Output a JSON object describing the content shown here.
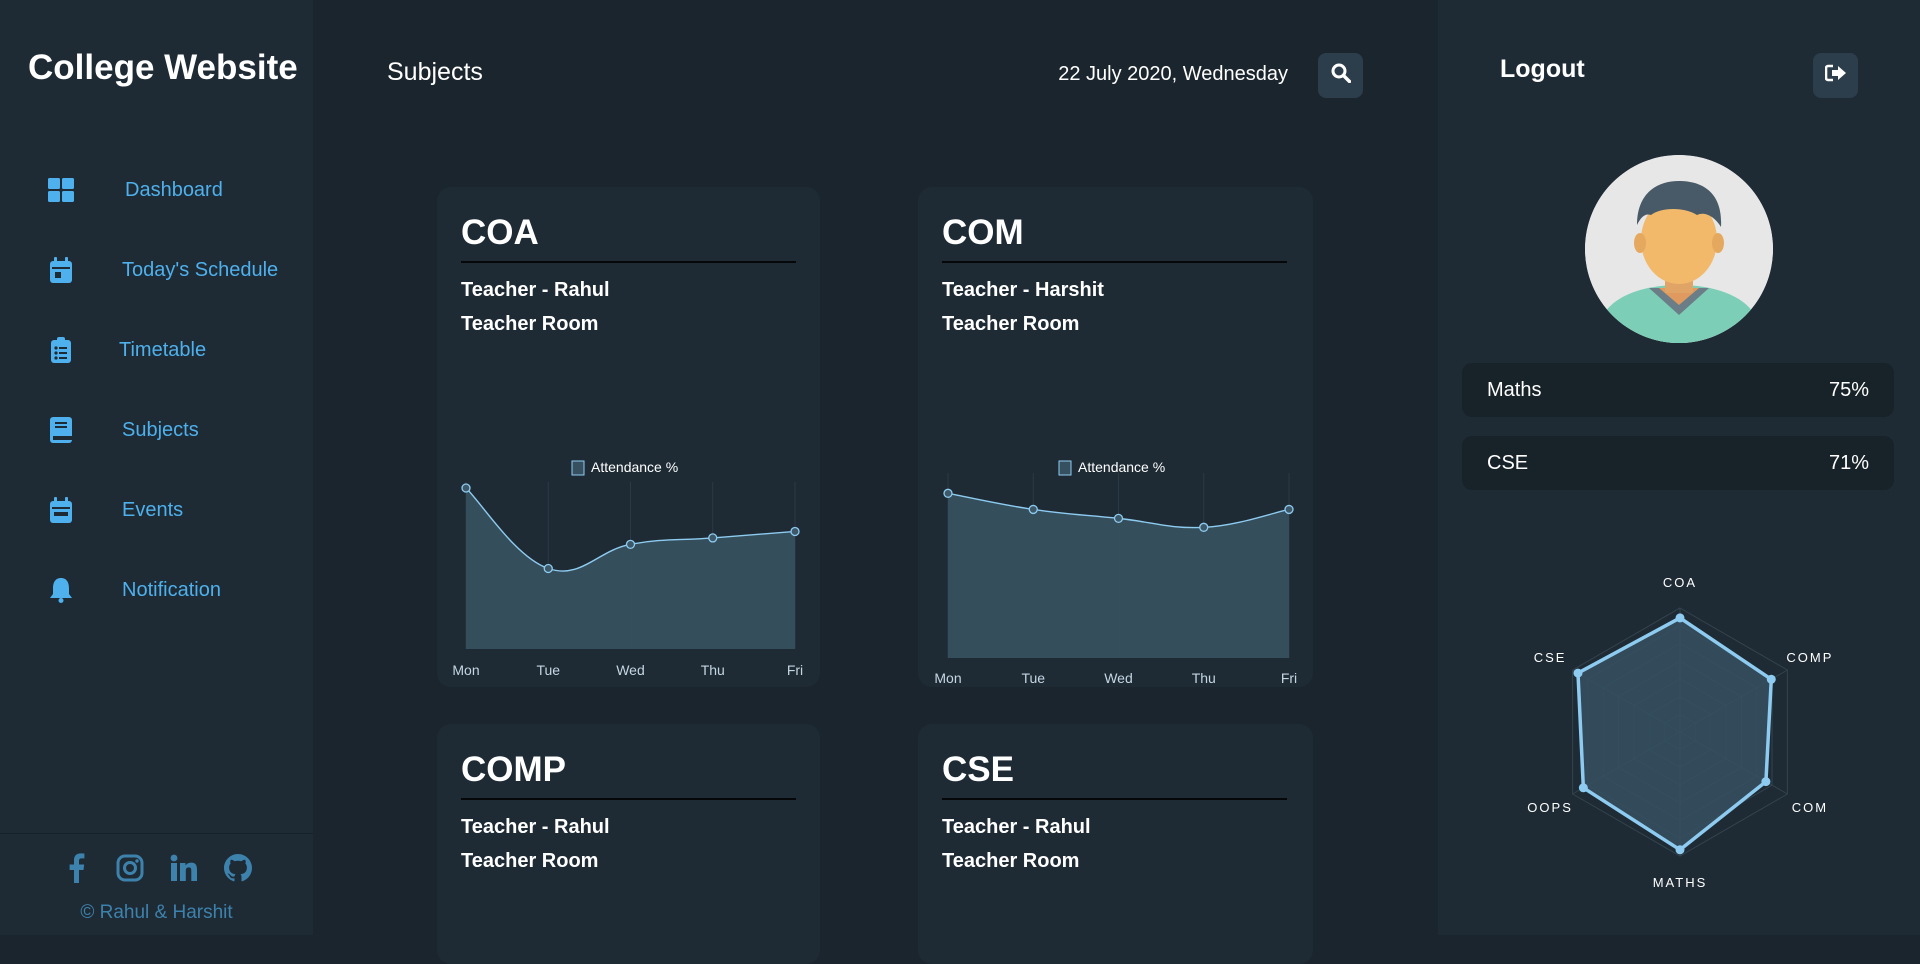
{
  "app": {
    "title": "College Website"
  },
  "sidebar": {
    "items": [
      {
        "label": "Dashboard",
        "icon": "dashboard-icon"
      },
      {
        "label": "Today's Schedule",
        "icon": "calendar-icon"
      },
      {
        "label": "Timetable",
        "icon": "clipboard-list-icon"
      },
      {
        "label": "Subjects",
        "icon": "book-icon"
      },
      {
        "label": "Events",
        "icon": "calendar-event-icon"
      },
      {
        "label": "Notification",
        "icon": "bell-icon"
      }
    ],
    "socials": [
      "facebook-icon",
      "instagram-icon",
      "linkedin-icon",
      "github-icon"
    ],
    "copyright": "© Rahul & Harshit"
  },
  "header": {
    "page_title": "Subjects",
    "date": "22 July 2020, Wednesday",
    "search_icon": "search-icon"
  },
  "subjects": [
    {
      "name": "COA",
      "teacher": "Teacher - Rahul",
      "room": "Teacher Room"
    },
    {
      "name": "COM",
      "teacher": "Teacher - Harshit",
      "room": "Teacher Room"
    },
    {
      "name": "COMP",
      "teacher": "Teacher - Rahul",
      "room": "Teacher Room"
    },
    {
      "name": "CSE",
      "teacher": "Teacher - Rahul",
      "room": "Teacher Room"
    }
  ],
  "chart_data": [
    {
      "type": "area",
      "subject": "COA",
      "legend": "Attendance %",
      "x": [
        "Mon",
        "Tue",
        "Wed",
        "Thu",
        "Fri"
      ],
      "series": [
        {
          "name": "Attendance %",
          "values": [
            100,
            50,
            65,
            69,
            73
          ]
        }
      ],
      "ylim": [
        0,
        100
      ],
      "grid": true,
      "legend_position": "top-center"
    },
    {
      "type": "area",
      "subject": "COM",
      "legend": "Attendance %",
      "x": [
        "Mon",
        "Tue",
        "Wed",
        "Thu",
        "Fri"
      ],
      "series": [
        {
          "name": "Attendance %",
          "values": [
            92,
            83,
            78,
            73,
            83
          ]
        }
      ],
      "ylim": [
        0,
        100
      ],
      "grid": true,
      "legend_position": "top-center"
    },
    {
      "type": "radar",
      "categories": [
        "COA",
        "COMP",
        "COM",
        "MATHS",
        "OOPS",
        "CSE"
      ],
      "series": [
        {
          "values": [
            92,
            85,
            80,
            95,
            90,
            95
          ]
        }
      ],
      "rlim": [
        0,
        100
      ],
      "grid": true
    }
  ],
  "profile": {
    "logout_label": "Logout",
    "logout_icon": "sign-out-icon",
    "avatar_icon": "user-avatar-icon",
    "stats": [
      {
        "subject": "Maths",
        "value": "75%"
      },
      {
        "subject": "CSE",
        "value": "71%"
      }
    ]
  },
  "colors": {
    "background": "#1b252d",
    "panel": "#1e2b35",
    "accent": "#4eb0ec",
    "chart_line": "#8ecbf0",
    "chart_fill": "#36505f"
  }
}
